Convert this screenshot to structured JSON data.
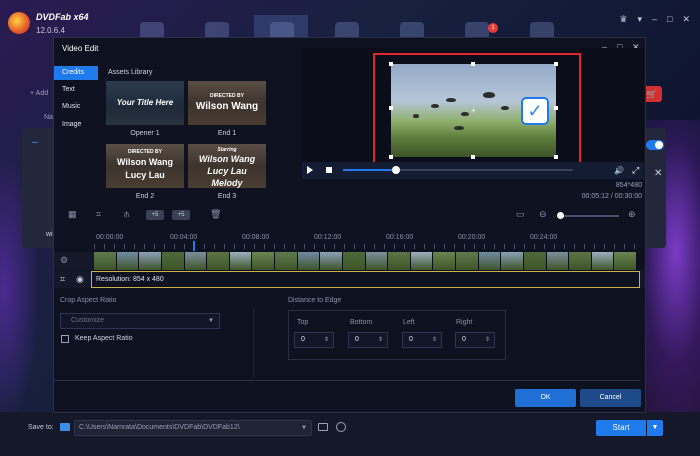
{
  "app": {
    "name": "DVDFab x64",
    "version": "12.0.6.4",
    "notification_count": "1",
    "add_label": "+ Add",
    "name_col": "Na",
    "item_prefix": "wi"
  },
  "bottom": {
    "save_to_label": "Save to:",
    "path": "C:\\Users\\Namrata\\Documents\\DVDFab\\DVDFab12\\",
    "start_label": "Start"
  },
  "dialog": {
    "title": "Video Edit",
    "side_tabs": [
      "Credits",
      "Text",
      "Music",
      "Image"
    ],
    "assets_title": "Assets Library",
    "assets": [
      {
        "thumb_lines": [
          "Your Title Here"
        ],
        "label": "Opener 1"
      },
      {
        "thumb_lines": [
          "DIRECTED BY",
          "Wilson Wang"
        ],
        "label": "End 1"
      },
      {
        "thumb_lines": [
          "DIRECTED BY",
          "Wilson Wang",
          "Lucy Lau"
        ],
        "label": "End 2"
      },
      {
        "thumb_lines": [
          "Starring",
          "Wilson Wang",
          "Lucy Lau",
          "Melody"
        ],
        "label": "End 3"
      }
    ],
    "player": {
      "progress": 0.23,
      "resolution": "854*480",
      "time": "00:05:12 / 00:30:00"
    },
    "timeline": {
      "ticks": [
        "00:00:00",
        "00:04:00",
        "00:08:00",
        "00:12:00",
        "00:16:00",
        "00:20:00",
        "00:24:00"
      ],
      "pill1": "+5",
      "pill2": "+5"
    },
    "resolution_text": "Resolution: 854 x 480",
    "crop": {
      "aspect_label": "Crop Aspect Ratio",
      "aspect_value": "Customize",
      "keep_label": "Keep Aspect Ratio",
      "distance_label": "Distance to Edge",
      "edges": [
        {
          "label": "Top",
          "value": "0"
        },
        {
          "label": "Bottom",
          "value": "0"
        },
        {
          "label": "Left",
          "value": "0"
        },
        {
          "label": "Right",
          "value": "0"
        }
      ]
    },
    "ok_label": "OK",
    "cancel_label": "Cancel"
  }
}
